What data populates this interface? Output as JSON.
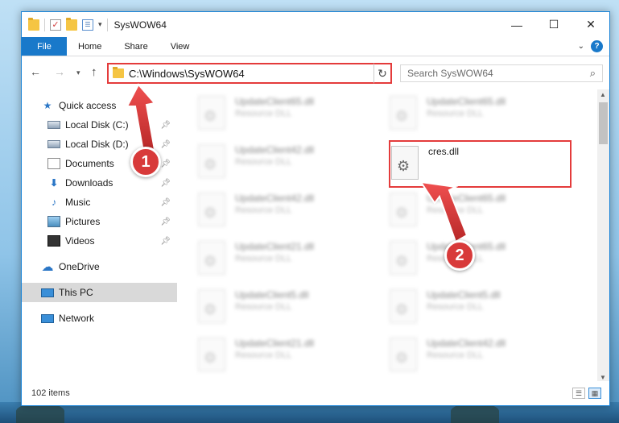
{
  "window": {
    "title": "SysWOW64",
    "controls": {
      "minimize": "—",
      "maximize": "☐",
      "close": "✕"
    }
  },
  "ribbon": {
    "tabs": [
      "File",
      "Home",
      "Share",
      "View"
    ]
  },
  "address": {
    "path": "C:\\Windows\\SysWOW64",
    "search_placeholder": "Search SysWOW64"
  },
  "nav": {
    "items": [
      {
        "label": "Quick access",
        "icon": "star-icon",
        "pinned": false
      },
      {
        "label": "Local Disk (C:)",
        "icon": "disk-icon",
        "pinned": true
      },
      {
        "label": "Local Disk (D:)",
        "icon": "disk-icon",
        "pinned": true
      },
      {
        "label": "Documents",
        "icon": "documents-icon",
        "pinned": true
      },
      {
        "label": "Downloads",
        "icon": "download-icon",
        "pinned": true
      },
      {
        "label": "Music",
        "icon": "music-icon",
        "pinned": true
      },
      {
        "label": "Pictures",
        "icon": "pictures-icon",
        "pinned": true
      },
      {
        "label": "Videos",
        "icon": "videos-icon",
        "pinned": true
      },
      {
        "label": "OneDrive",
        "icon": "cloud-icon",
        "pinned": false
      },
      {
        "label": "This PC",
        "icon": "pc-icon",
        "pinned": false
      },
      {
        "label": "Network",
        "icon": "network-icon",
        "pinned": false
      }
    ]
  },
  "files": {
    "left_column": [
      {
        "name": "UpdateClient65.dll",
        "type": "Resource DLL"
      },
      {
        "name": "UpdateClient42.dll",
        "type": "Resource DLL"
      },
      {
        "name": "UpdateClient42.dll",
        "type": "Resource DLL"
      },
      {
        "name": "UpdateClient21.dll",
        "type": "Resource DLL"
      },
      {
        "name": "UpdateClient5.dll",
        "type": "Resource DLL"
      },
      {
        "name": "UpdateClient21.dll",
        "type": "Resource DLL"
      }
    ],
    "right_column": [
      {
        "name": "UpdateClient65.dll",
        "type": "Resource DLL"
      },
      {
        "name": "cres.dll",
        "type": ""
      },
      {
        "name": "UpdateClient65.dll",
        "type": "Resource DLL"
      },
      {
        "name": "UpdateClient65.dll",
        "type": "Resource DLL"
      },
      {
        "name": "UpdateClient5.dll",
        "type": "Resource DLL"
      },
      {
        "name": "UpdateClient42.dll",
        "type": "Resource DLL"
      }
    ]
  },
  "status": {
    "item_count": "102 items"
  },
  "annotations": {
    "step1": "1",
    "step2": "2",
    "color": "#d83a3a"
  },
  "colors": {
    "accent": "#1979ca",
    "highlight": "#e43b3b"
  }
}
